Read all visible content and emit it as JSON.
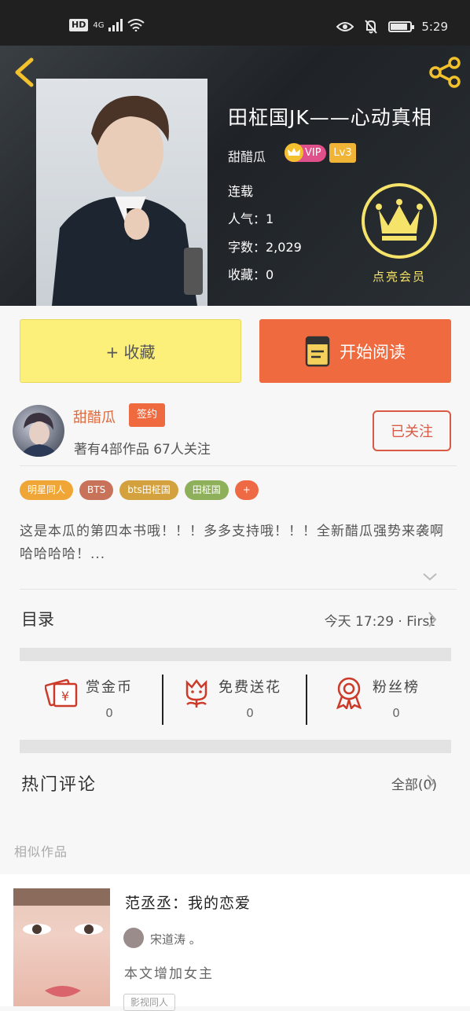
{
  "status_bar": {
    "hd": "HD",
    "signal": "4G",
    "time": "5:29",
    "battery_level": 0.85
  },
  "hero": {
    "title": "田柾国JK——心动真相",
    "author": "甜醋瓜",
    "vip_label": "VIP",
    "level": "Lv3",
    "status": "连载",
    "popularity": "人气：1",
    "word_count": "字数：2,029",
    "favorites": "收藏：0",
    "member_label": "点亮会员",
    "colors": {
      "accent_yellow": "#f5e36a"
    }
  },
  "actions": {
    "favorite_label": "+ 收藏",
    "read_label": "开始阅读",
    "colors": {
      "favorite_bg": "#fdf07a",
      "read_bg": "#ef6a3f"
    }
  },
  "author_info": {
    "name": "甜醋瓜",
    "sign_badge": "签约",
    "summary": "著有4部作品 67人关注",
    "follow_label": "已关注"
  },
  "tags": [
    {
      "label": "明星同人",
      "color": "#f0a637"
    },
    {
      "label": "BTS",
      "color": "#c8725a"
    },
    {
      "label": "bts田柾国",
      "color": "#d4a13f"
    },
    {
      "label": "田柾国",
      "color": "#8fb05a"
    },
    {
      "label": "+",
      "color": "#ee6a44"
    }
  ],
  "description": "这是本瓜的第四本书哦！！！多多支持哦！！！全新醋瓜强势来袭啊哈哈哈哈！...",
  "catalog": {
    "title": "目录",
    "latest": "今天 17:29 · First"
  },
  "stats": [
    {
      "label": "赏金币",
      "count": "0",
      "icon": "coin-envelope-icon"
    },
    {
      "label": "免费送花",
      "count": "0",
      "icon": "flower-icon"
    },
    {
      "label": "粉丝榜",
      "count": "0",
      "icon": "ribbon-medal-icon"
    }
  ],
  "comments": {
    "title": "热门评论",
    "all_label": "全部(0)"
  },
  "similar": {
    "section_title": "相似作品",
    "items": [
      {
        "title": "范丞丞：我的恋爱",
        "author": "宋道涛 。",
        "desc": "本文增加女主",
        "tag": "影视同人"
      }
    ]
  }
}
